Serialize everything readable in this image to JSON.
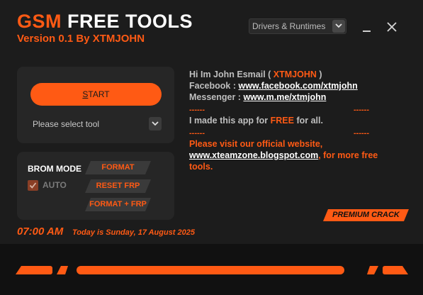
{
  "app": {
    "title_brand": "GSM",
    "title_rest": "FREE TOOLS",
    "version": "Version 0.1 By XTMJOHN",
    "accent_color": "#ff5a14"
  },
  "header": {
    "dropdown_value": "Drivers & Runtimes",
    "minimize_icon": "minimize-icon",
    "close_icon": "close-icon"
  },
  "tool_panel": {
    "start_label_first": "S",
    "start_label_rest": "TART",
    "select_label": "Please select tool"
  },
  "brom_panel": {
    "mode_label": "BROM MODE",
    "auto_label": "AUTO",
    "auto_checked": true,
    "format_label": "FORMAT",
    "reset_frp_label": "RESET FRP",
    "format_frp_label": "FORMAT + FRP"
  },
  "info": {
    "greeting_prefix": "Hi Im John Esmail (",
    "greeting_name": "XTMJOHN",
    "greeting_suffix": ")",
    "facebook_label": "Facebook :",
    "facebook_link": "www.facebook.com/xtmjohn",
    "messenger_label": "Messenger :",
    "messenger_link": "www.m.me/xtmjohn",
    "dashes": "------",
    "free_prefix": "I made this app for",
    "free_word": "FREE",
    "free_suffix": "for all.",
    "visit_line1": "Please visit our official website,",
    "website_link": "www.xteamzone.blogspot.com",
    "visit_line2_suffix": ", for more free",
    "visit_line3": "tools."
  },
  "premium_label": "PREMIUM CRACK",
  "status": {
    "time": "07:00 AM",
    "today": "Today is Sunday,  17 August 2025"
  }
}
